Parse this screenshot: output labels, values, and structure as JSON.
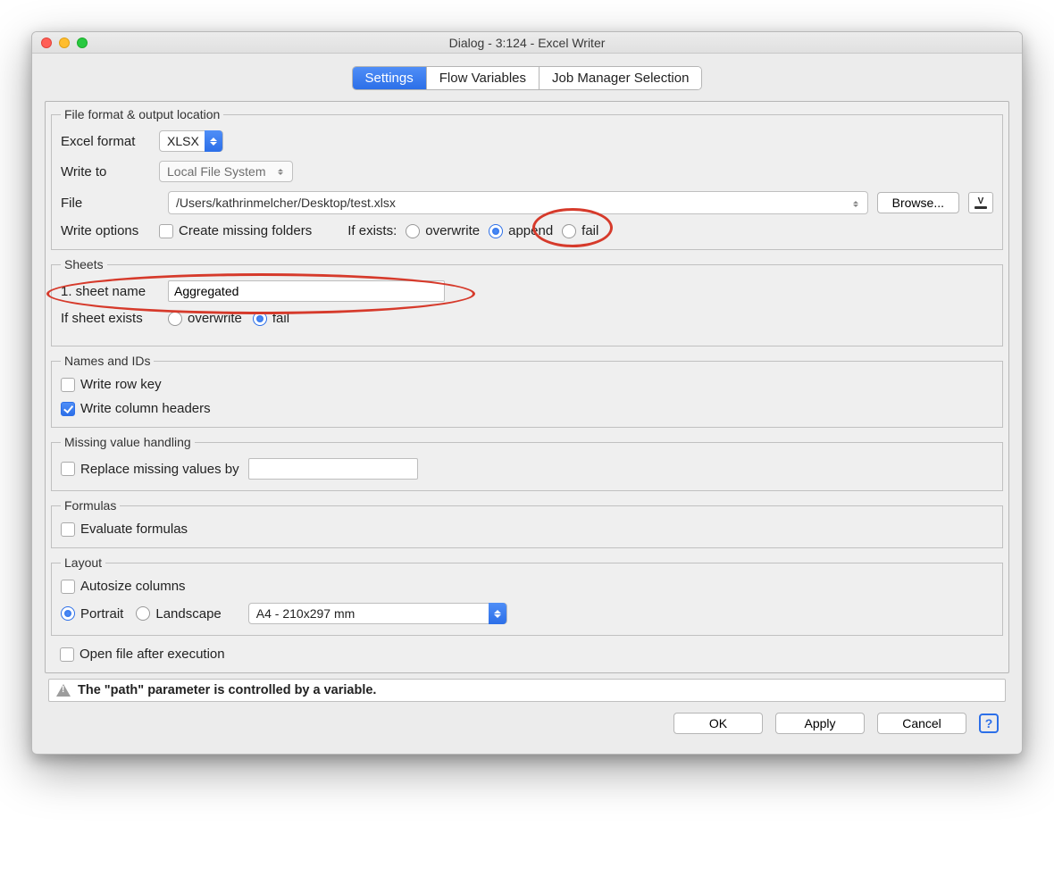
{
  "window": {
    "title": "Dialog - 3:124 - Excel Writer"
  },
  "tabs": {
    "settings": "Settings",
    "flow": "Flow Variables",
    "job": "Job Manager Selection"
  },
  "fileformat": {
    "legend": "File format & output location",
    "format_label": "Excel format",
    "format_value": "XLSX",
    "writeto_label": "Write to",
    "writeto_value": "Local File System",
    "file_label": "File",
    "file_value": "/Users/kathrinmelcher/Desktop/test.xlsx",
    "browse": "Browse...",
    "write_options_label": "Write options",
    "create_folders": "Create missing folders",
    "if_exists": "If exists:",
    "overwrite": "overwrite",
    "append": "append",
    "fail": "fail"
  },
  "sheets": {
    "legend": "Sheets",
    "name_label": "1. sheet name",
    "name_value": "Aggregated",
    "if_exists": "If sheet exists",
    "overwrite": "overwrite",
    "fail": "fail"
  },
  "names": {
    "legend": "Names and IDs",
    "row_key": "Write row key",
    "col_headers": "Write column headers"
  },
  "missing": {
    "legend": "Missing value handling",
    "replace": "Replace missing values by"
  },
  "formulas": {
    "legend": "Formulas",
    "eval": "Evaluate formulas"
  },
  "layout": {
    "legend": "Layout",
    "autosize": "Autosize columns",
    "portrait": "Portrait",
    "landscape": "Landscape",
    "paper": "A4 - 210x297 mm"
  },
  "open_after": "Open file after execution",
  "footer_msg": "The \"path\" parameter is controlled by a variable.",
  "buttons": {
    "ok": "OK",
    "apply": "Apply",
    "cancel": "Cancel"
  }
}
